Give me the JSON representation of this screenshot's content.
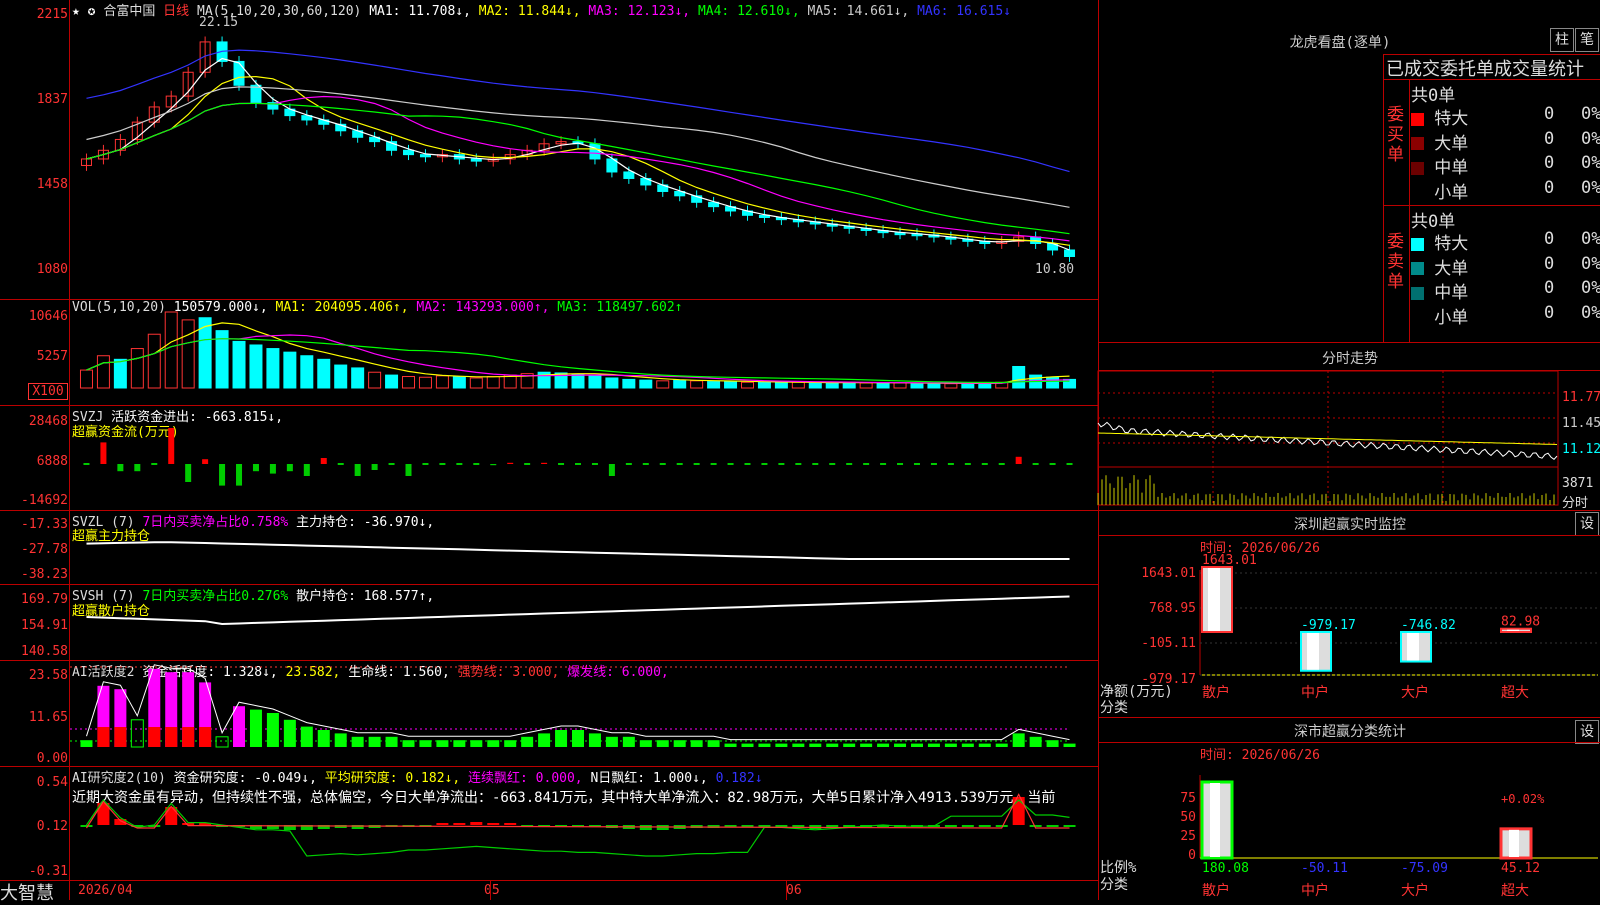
{
  "header": {
    "stock_name": "合富中国",
    "chart_type": "日线",
    "ma_params": "MA(5,10,20,30,60,120)",
    "ma1": "MA1: 11.708↓,",
    "ma2": "MA2: 11.844↓,",
    "ma3": "MA3: 12.123↓,",
    "ma4": "MA4: 12.610↓,",
    "ma5": "MA5: 14.661↓,",
    "ma6": "MA6: 16.615↓",
    "high_label": "22.15",
    "low_label": "10.80"
  },
  "price_axis": [
    "2215",
    "1837",
    "1458",
    "1080"
  ],
  "vol": {
    "label": "VOL(5,10,20)",
    "value": "150579.000↓,",
    "ma1": "MA1: 204095.406↑,",
    "ma2": "MA2: 143293.000↑,",
    "ma3": "MA3: 118497.602↑",
    "axis": [
      "10646",
      "5257",
      "X100"
    ]
  },
  "svzj": {
    "label": "SVZJ",
    "text": "活跃资金进出: -663.815↓,",
    "subtitle": "超赢资金流(万元)",
    "axis": [
      "28468",
      "6888",
      "-14692"
    ]
  },
  "svzl": {
    "label": "SVZL (7)",
    "ratio": "7日内买卖净占比0.758%",
    "text": "主力持仓: -36.970↓,",
    "subtitle": "超赢主力持仓",
    "axis": [
      "-17.33",
      "-27.78",
      "-38.23"
    ]
  },
  "svsh": {
    "label": "SVSH (7)",
    "ratio": "7日内买卖净占比0.276%",
    "text": "散户持仓: 168.577↑,",
    "subtitle": "超赢散户持仓",
    "axis": [
      "169.79",
      "154.91",
      "140.58"
    ]
  },
  "ai_active": {
    "label": "AI活跃度2",
    "t1": "资金活跃度: 1.328↓,",
    "t2": "23.582,",
    "t3": "生命线: 1.560,",
    "t4": "强势线: 3.000,",
    "t5": "爆发线: 6.000,",
    "axis": [
      "23.58",
      "11.65",
      "0.00"
    ]
  },
  "ai_research": {
    "label": "AI研究度2(10)",
    "t1": "资金研究度: -0.049↓,",
    "t2": "平均研究度: 0.182↓,",
    "t3": "连续飘红: 0.000,",
    "t4": "N日飘红: 1.000↓,",
    "t5": "0.182↓",
    "commentary": "近期大资金虽有异动，但持续性不强，总体偏空，今日大单净流出：-663.841万元，其中特大单净流入：82.98万元，大单5日累计净入4913.539万元，当前",
    "axis": [
      "0.54",
      "0.12",
      "-0.31"
    ]
  },
  "dates": [
    "2026/04",
    "05",
    "06"
  ],
  "app_name": "大智慧",
  "right_panel": {
    "lhb_title": "龙虎看盘(逐单)",
    "btn1": "柱",
    "btn2": "笔",
    "stats_title": "已成交委托单成交量统计",
    "buy": {
      "side": "委买单",
      "total": "共0单",
      "rows": [
        {
          "label": "特大",
          "count": "0",
          "pct": "0%",
          "color": "#ff0000"
        },
        {
          "label": "大单",
          "count": "0",
          "pct": "0%",
          "color": "#8b0000"
        },
        {
          "label": "中单",
          "count": "0",
          "pct": "0%",
          "color": "#6b0000"
        },
        {
          "label": "小单",
          "count": "0",
          "pct": "0%",
          "color": "#000000"
        }
      ]
    },
    "sell": {
      "side": "委卖单",
      "total": "共0单",
      "rows": [
        {
          "label": "特大",
          "count": "0",
          "pct": "0%",
          "color": "#00ffff"
        },
        {
          "label": "大单",
          "count": "0",
          "pct": "0%",
          "color": "#008b8b"
        },
        {
          "label": "中单",
          "count": "0",
          "pct": "0%",
          "color": "#007070"
        },
        {
          "label": "小单",
          "count": "0",
          "pct": "0%",
          "color": "#000000"
        }
      ]
    },
    "intraday": {
      "title": "分时走势",
      "axis": [
        "11.77",
        "11.45",
        "11.12"
      ],
      "vol_label": "3871",
      "time_label": "分时"
    },
    "sz_monitor": {
      "title": "深圳超赢实时监控",
      "btn": "设",
      "date": "时间: 2026/06/26",
      "axis": [
        "1643.01",
        "768.95",
        "-105.11",
        "-979.17"
      ],
      "ylabel": "净额(万元)",
      "xlabel": "分类",
      "categories": [
        "散户",
        "中户",
        "大户",
        "超大"
      ],
      "values": [
        1643.01,
        -979.17,
        -746.82,
        82.98
      ],
      "value_labels": [
        "1643.01",
        "-979.17",
        "-746.82",
        "82.98"
      ]
    },
    "sz_class": {
      "title": "深市超赢分类统计",
      "btn": "设",
      "date": "时间: 2026/06/26",
      "axis": [
        "75",
        "50",
        "25",
        "0"
      ],
      "ylabel": "比例%",
      "xlabel": "分类",
      "categories": [
        "散户",
        "中户",
        "大户",
        "超大"
      ],
      "values": [
        180.08,
        -50.11,
        -75.09,
        45.12
      ],
      "value_labels": [
        "180.08",
        "-50.11",
        "-75.09",
        "45.12"
      ],
      "top_label": "+0.02%"
    }
  },
  "chart_data": {
    "type": "line",
    "title": "",
    "xlabel": "",
    "ylabel": "",
    "note": "daily candlestick series (approximate)",
    "x": [
      "2026/04",
      "05",
      "06"
    ],
    "ylim": [
      10.8,
      22.15
    ],
    "series": [
      {
        "name": "close",
        "values": [
          15.6,
          16.0,
          16.5,
          17.3,
          18.0,
          18.5,
          19.6,
          21.0,
          20.1,
          19.0,
          18.2,
          17.9,
          17.6,
          17.4,
          17.2,
          16.9,
          16.6,
          16.4,
          16.0,
          15.8,
          15.7,
          15.8,
          15.6,
          15.5,
          15.6,
          15.8,
          16.0,
          16.3,
          16.4,
          16.3,
          15.6,
          15.0,
          14.7,
          14.4,
          14.1,
          13.9,
          13.6,
          13.4,
          13.2,
          13.0,
          12.9,
          12.8,
          12.7,
          12.6,
          12.5,
          12.4,
          12.3,
          12.2,
          12.15,
          12.1,
          12.0,
          11.9,
          11.8,
          11.7,
          11.8,
          12.0,
          11.7,
          11.4,
          11.1
        ]
      }
    ]
  }
}
